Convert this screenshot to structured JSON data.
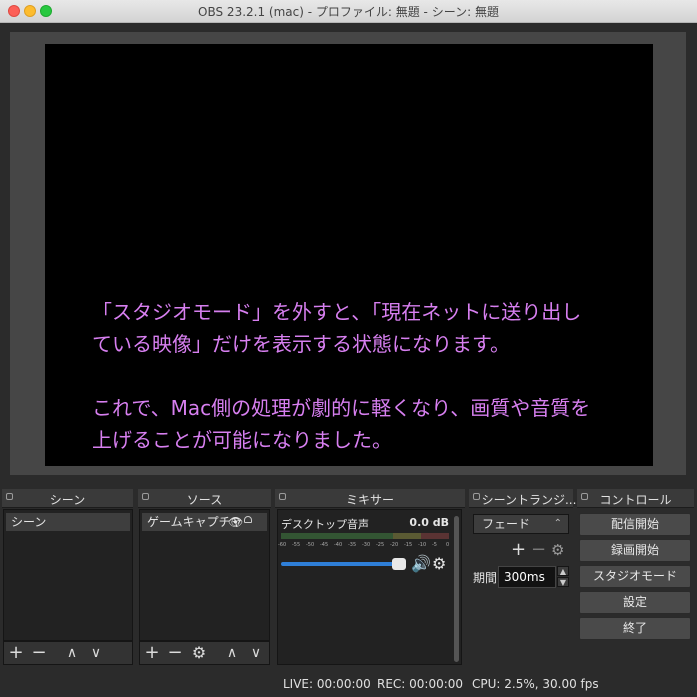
{
  "window": {
    "title": "OBS 23.2.1 (mac) - プロファイル: 無題 - シーン: 無題"
  },
  "preview": {
    "overlay_lines": [
      "「スタジオモード」を外すと、「現在ネットに送り出し",
      "ている映像」だけを表示する状態になります。",
      "これで、Mac側の処理が劇的に軽くなり、画質や音質を",
      "上げることが可能になりました。"
    ]
  },
  "docks": {
    "scenes": {
      "title": "シーン",
      "items": [
        "シーン"
      ]
    },
    "sources": {
      "title": "ソース",
      "items": [
        "ゲームキャプチャ"
      ]
    },
    "mixer": {
      "title": "ミキサー",
      "channel": {
        "name": "デスクトップ音声",
        "level": "0.0 dB"
      },
      "ticks": [
        "-60",
        "-55",
        "-50",
        "-45",
        "-40",
        "-35",
        "-30",
        "-25",
        "-20",
        "-15",
        "-10",
        "-5",
        "0"
      ],
      "volume_fraction": 0.95
    },
    "transitions": {
      "title": "シーントランジ...",
      "selected": "フェード",
      "duration_label": "期間",
      "duration_value": "300ms"
    },
    "controls": {
      "title": "コントロール",
      "buttons": [
        "配信開始",
        "録画開始",
        "スタジオモード",
        "設定",
        "終了"
      ]
    }
  },
  "statusbar": {
    "live": "LIVE: 00:00:00",
    "rec": "REC: 00:00:00",
    "cpu": "CPU: 2.5%, 30.00 fps"
  },
  "colors": {
    "overlay_text": "#d77ff0",
    "volume_slider": "#2f7fd8",
    "meter_green": "#335533"
  }
}
